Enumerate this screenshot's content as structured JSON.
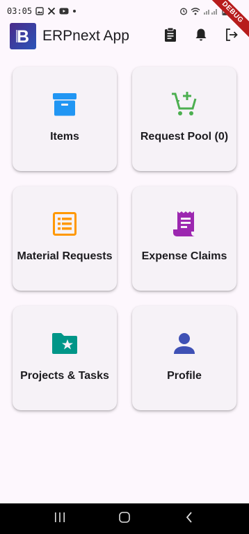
{
  "status_bar": {
    "time": "03:05",
    "battery_level": "low"
  },
  "debug_banner": "DEBUG",
  "app_bar": {
    "title": "ERPnext App",
    "logo_letter": "B"
  },
  "grid": {
    "items": [
      {
        "label": "Items",
        "icon": "archive-box-icon",
        "color": "#2196f3"
      },
      {
        "label": "Request Pool (0)",
        "icon": "add-shopping-cart-icon",
        "color": "#4caf50"
      },
      {
        "label": "Material Requests",
        "icon": "list-alt-icon",
        "color": "#ff9800"
      },
      {
        "label": "Expense Claims",
        "icon": "receipt-icon",
        "color": "#9c27b0"
      },
      {
        "label": "Projects & Tasks",
        "icon": "folder-star-icon",
        "color": "#009688"
      },
      {
        "label": "Profile",
        "icon": "person-icon",
        "color": "#3f51b5"
      }
    ]
  },
  "colors": {
    "background": "#fdf7fd",
    "card": "#f6f2f7"
  }
}
